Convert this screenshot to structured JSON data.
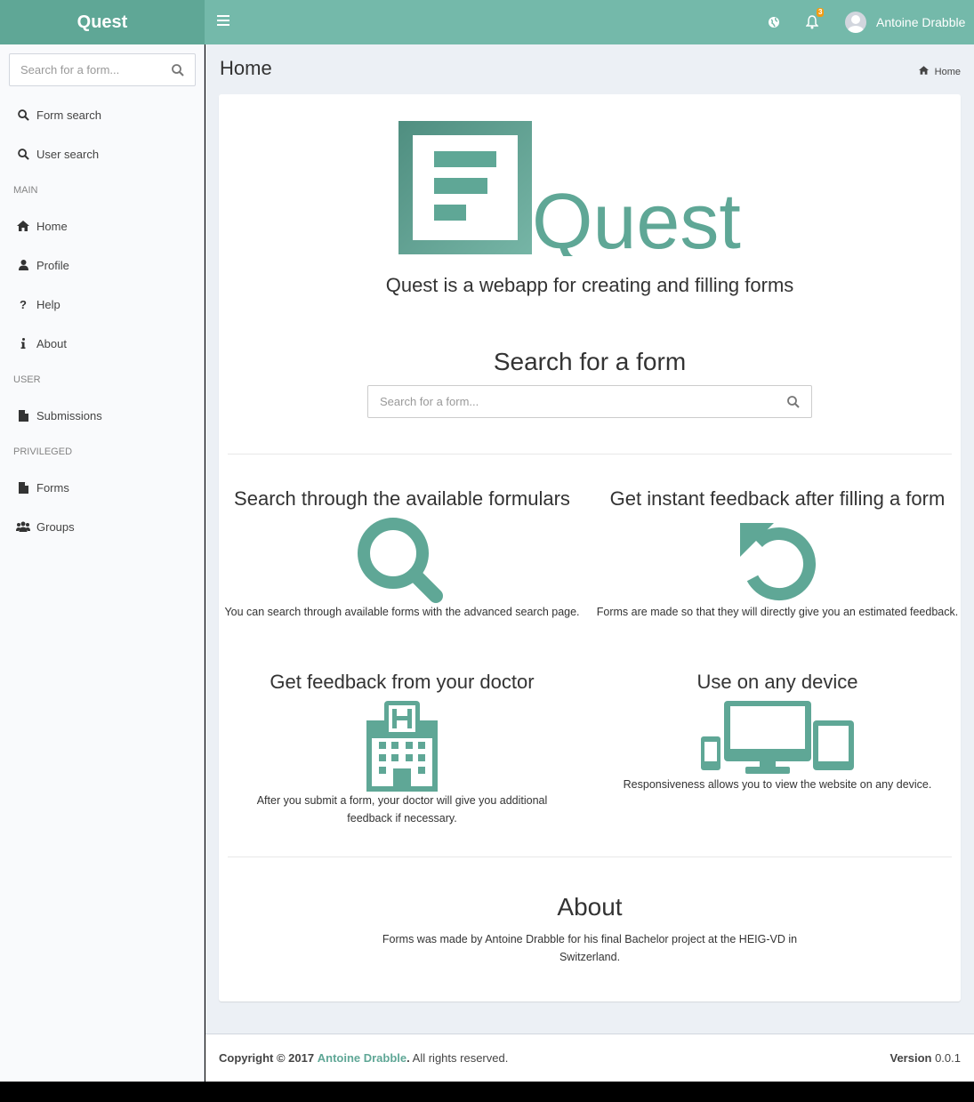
{
  "app": {
    "logo_text": "Quest",
    "brand_color": "#5fa796",
    "header_color": "#74b9aa"
  },
  "header": {
    "user_name": "Antoine Drabble",
    "notification_count": "3"
  },
  "sidebar": {
    "search_placeholder": "Search for a form...",
    "quick_items": [
      {
        "label": "Form search",
        "icon": "search-icon"
      },
      {
        "label": "User search",
        "icon": "search-icon"
      }
    ],
    "sections": [
      {
        "header": "MAIN",
        "items": [
          {
            "label": "Home",
            "icon": "home-icon"
          },
          {
            "label": "Profile",
            "icon": "user-icon"
          },
          {
            "label": "Help",
            "icon": "question-icon"
          },
          {
            "label": "About",
            "icon": "info-icon"
          }
        ]
      },
      {
        "header": "USER",
        "items": [
          {
            "label": "Submissions",
            "icon": "file-icon"
          }
        ]
      },
      {
        "header": "PRIVILEGED",
        "items": [
          {
            "label": "Forms",
            "icon": "file-icon"
          },
          {
            "label": "Groups",
            "icon": "users-icon"
          }
        ]
      }
    ]
  },
  "page": {
    "title": "Home",
    "breadcrumb": "Home"
  },
  "hero": {
    "logo_word": "Quest",
    "tagline": "Quest is a webapp for creating and filling forms",
    "search_title": "Search for a form",
    "search_placeholder": "Search for a form..."
  },
  "features": [
    {
      "title": "Search through the available formulars",
      "icon": "search-icon",
      "text": "You can search through available forms with the advanced search page."
    },
    {
      "title": "Get instant feedback after filling a form",
      "icon": "undo-icon",
      "text": "Forms are made so that they will directly give you an estimated feedback."
    },
    {
      "title": "Get feedback from your doctor",
      "icon": "hospital-icon",
      "text": "After you submit a form, your doctor will give you additional feedback if necessary."
    },
    {
      "title": "Use on any device",
      "icon": "devices-icon",
      "text": "Responsiveness allows you to view the website on any device."
    }
  ],
  "about": {
    "title": "About",
    "text": "Forms was made by Antoine Drabble for his final Bachelor project at the HEIG-VD in Switzerland."
  },
  "footer": {
    "copyright_prefix": "Copyright © 2017",
    "author": "Antoine Drabble",
    "rights": "All rights reserved.",
    "version_label": "Version",
    "version": "0.0.1"
  }
}
